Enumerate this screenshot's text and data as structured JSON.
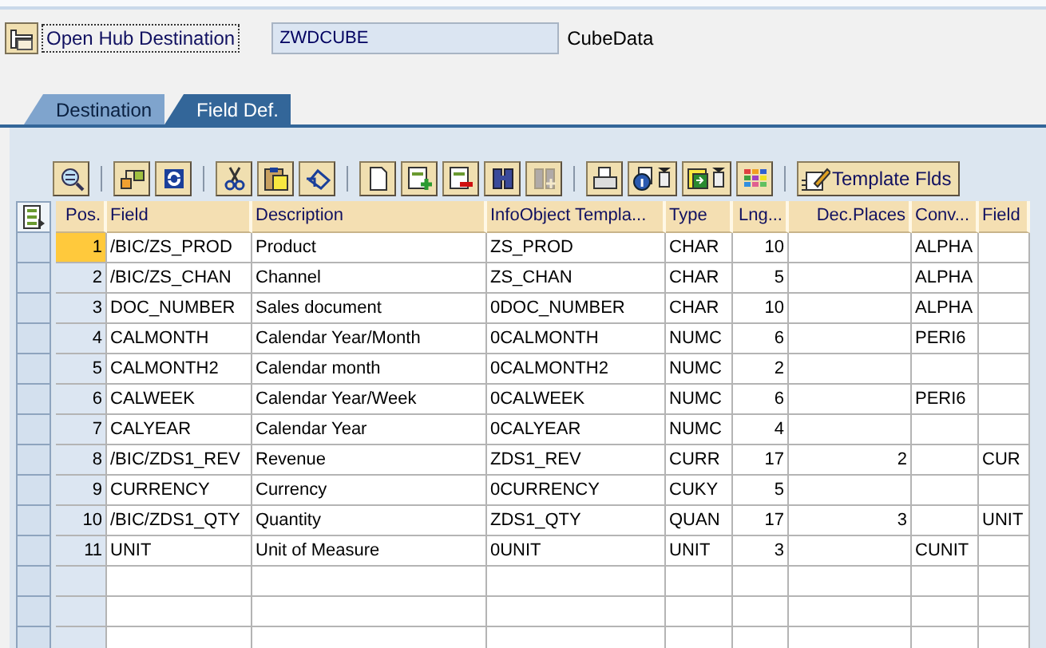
{
  "header": {
    "button_label": "Open Hub Destination",
    "value": "ZWDCUBE",
    "description": "CubeData"
  },
  "tabs": [
    {
      "label": "Destination",
      "selected": false
    },
    {
      "label": "Field Def.",
      "selected": true
    }
  ],
  "toolbar": [
    {
      "kind": "icon",
      "disabled": false
    },
    {
      "kind": "separator"
    },
    {
      "kind": "icon",
      "disabled": false
    },
    {
      "kind": "icon",
      "disabled": false
    },
    {
      "kind": "separator"
    },
    {
      "kind": "icon",
      "disabled": false
    },
    {
      "kind": "icon",
      "disabled": false
    },
    {
      "kind": "icon",
      "disabled": false
    },
    {
      "kind": "separator"
    },
    {
      "kind": "icon",
      "disabled": false
    },
    {
      "kind": "icon",
      "disabled": false
    },
    {
      "kind": "icon",
      "disabled": false
    },
    {
      "kind": "icon",
      "disabled": false
    },
    {
      "kind": "icon",
      "disabled": true
    },
    {
      "kind": "separator"
    },
    {
      "kind": "icon",
      "disabled": false
    },
    {
      "kind": "menu",
      "disabled": false
    },
    {
      "kind": "menu",
      "disabled": false
    },
    {
      "kind": "icon",
      "disabled": false
    },
    {
      "kind": "separator"
    },
    {
      "kind": "text",
      "label": "Template Flds",
      "disabled": false
    }
  ],
  "table": {
    "columns": [
      {
        "label": "Pos.",
        "numeric": true
      },
      {
        "label": "Field",
        "numeric": false
      },
      {
        "label": "Description",
        "numeric": false
      },
      {
        "label": "InfoObject Templa...",
        "numeric": false
      },
      {
        "label": "Type",
        "numeric": false
      },
      {
        "label": "Lng...",
        "numeric": true
      },
      {
        "label": "Dec.Places",
        "numeric": true
      },
      {
        "label": "Conv...",
        "numeric": false
      },
      {
        "label": "Field",
        "numeric": false
      }
    ],
    "rows": [
      {
        "cells": [
          "1",
          "/BIC/ZS_PROD",
          "Product",
          "ZS_PROD",
          "CHAR",
          "10",
          null,
          "ALPHA",
          null
        ],
        "focused": true
      },
      {
        "cells": [
          "2",
          "/BIC/ZS_CHAN",
          "Channel",
          "ZS_CHAN",
          "CHAR",
          "5",
          null,
          "ALPHA",
          null
        ],
        "focused": false
      },
      {
        "cells": [
          "3",
          "DOC_NUMBER",
          "Sales document",
          "0DOC_NUMBER",
          "CHAR",
          "10",
          null,
          "ALPHA",
          null
        ],
        "focused": false
      },
      {
        "cells": [
          "4",
          "CALMONTH",
          "Calendar Year/Month",
          "0CALMONTH",
          "NUMC",
          "6",
          null,
          "PERI6",
          null
        ],
        "focused": false
      },
      {
        "cells": [
          "5",
          "CALMONTH2",
          "Calendar month",
          "0CALMONTH2",
          "NUMC",
          "2",
          null,
          null,
          null
        ],
        "focused": false
      },
      {
        "cells": [
          "6",
          "CALWEEK",
          "Calendar Year/Week",
          "0CALWEEK",
          "NUMC",
          "6",
          null,
          "PERI6",
          null
        ],
        "focused": false
      },
      {
        "cells": [
          "7",
          "CALYEAR",
          "Calendar Year",
          "0CALYEAR",
          "NUMC",
          "4",
          null,
          null,
          null
        ],
        "focused": false
      },
      {
        "cells": [
          "8",
          "/BIC/ZDS1_REV",
          "Revenue",
          "ZDS1_REV",
          "CURR",
          "17",
          "2",
          null,
          "CUR"
        ],
        "focused": false
      },
      {
        "cells": [
          "9",
          "CURRENCY",
          "Currency",
          "0CURRENCY",
          "CUKY",
          "5",
          null,
          null,
          null
        ],
        "focused": false
      },
      {
        "cells": [
          "10",
          "/BIC/ZDS1_QTY",
          "Quantity",
          "ZDS1_QTY",
          "QUAN",
          "17",
          "3",
          null,
          "UNIT"
        ],
        "focused": false
      },
      {
        "cells": [
          "11",
          "UNIT",
          "Unit of Measure",
          "0UNIT",
          "UNIT",
          "3",
          null,
          "CUNIT",
          null
        ],
        "focused": false
      }
    ]
  }
}
